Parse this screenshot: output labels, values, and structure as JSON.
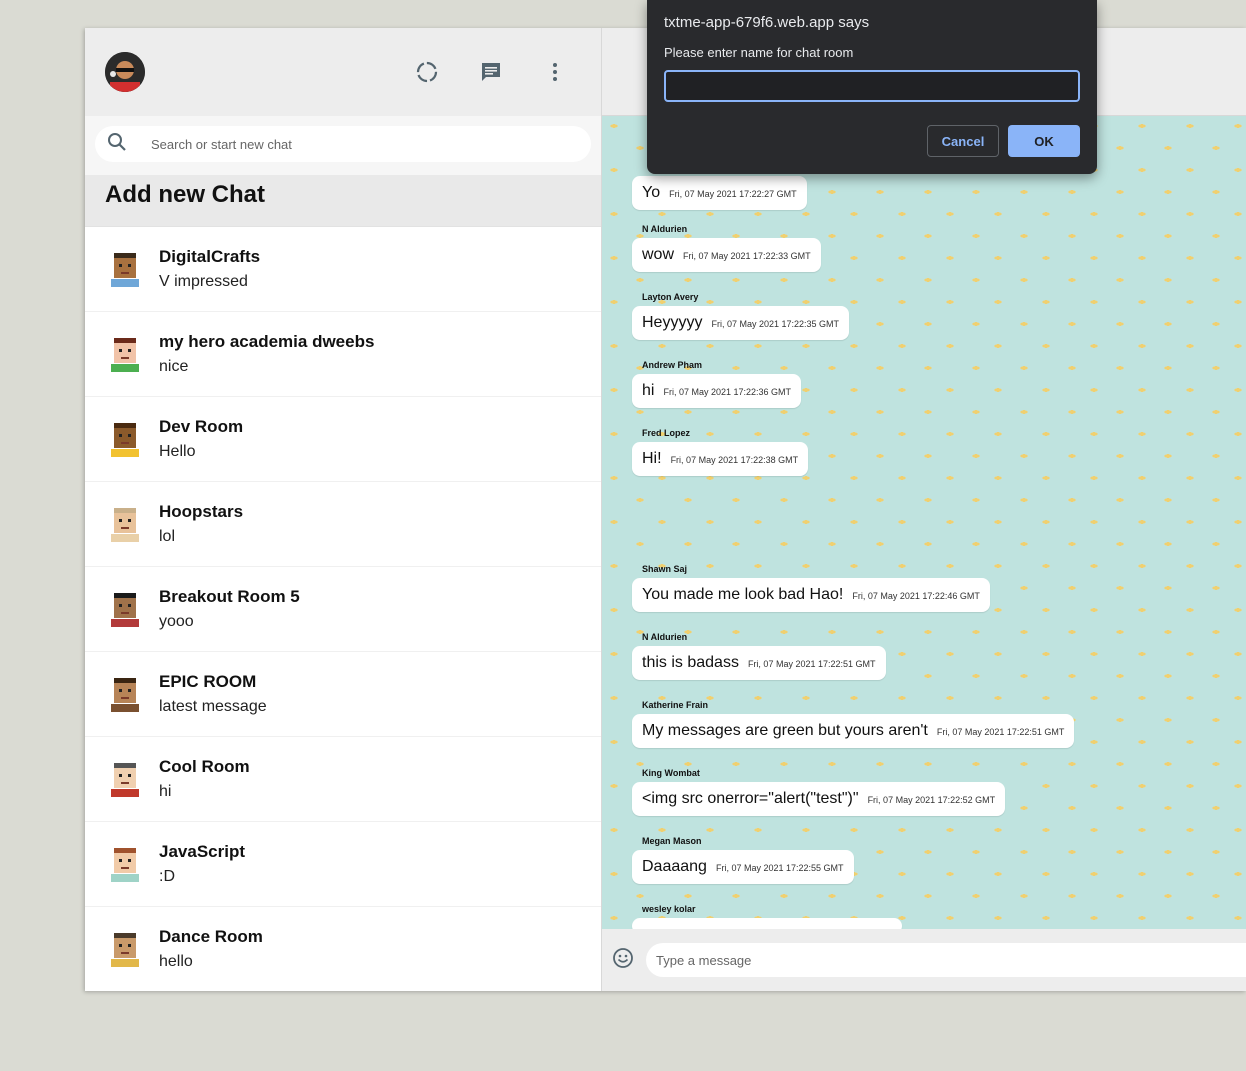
{
  "sidebar": {
    "search_placeholder": "Search or start new chat",
    "add_chat_label": "Add new Chat",
    "chats": [
      {
        "name": "DigitalCrafts",
        "last": "V impressed",
        "skin": "#a8713f",
        "shirt": "#6fa7d8",
        "hair": "#3a2a1a"
      },
      {
        "name": "my hero academia dweebs",
        "last": "nice",
        "skin": "#f1c3a8",
        "shirt": "#4caf50",
        "hair": "#6b2a1a"
      },
      {
        "name": "Dev Room",
        "last": "Hello",
        "skin": "#8b5a2b",
        "shirt": "#f2c230",
        "hair": "#4a2a10"
      },
      {
        "name": "Hoopstars",
        "last": "lol",
        "skin": "#e8c29a",
        "shirt": "#e9d0a8",
        "hair": "#c9b08a"
      },
      {
        "name": "Breakout Room 5",
        "last": "yooo",
        "skin": "#a0724a",
        "shirt": "#b23a3a",
        "hair": "#1a1a1a"
      },
      {
        "name": "EPIC ROOM",
        "last": "latest message",
        "skin": "#b78457",
        "shirt": "#7a5030",
        "hair": "#3a2512"
      },
      {
        "name": "Cool Room",
        "last": "hi",
        "skin": "#f0d0b0",
        "shirt": "#c0392b",
        "hair": "#555555"
      },
      {
        "name": "JavaScript",
        "last": ":D",
        "skin": "#f1cba8",
        "shirt": "#9fd3c7",
        "hair": "#a0522d"
      },
      {
        "name": "Dance Room",
        "last": "hello",
        "skin": "#c99a6a",
        "shirt": "#e2b84a",
        "hair": "#4a3a2a"
      }
    ]
  },
  "messages": [
    {
      "sender": "",
      "text": "Yo",
      "time": "Fri, 07 May 2021 17:22:27 GMT"
    },
    {
      "sender": "N Aldurien",
      "text": "wow",
      "time": "Fri, 07 May 2021 17:22:33 GMT"
    },
    {
      "sender": "Layton Avery",
      "text": "Heyyyyy",
      "time": "Fri, 07 May 2021 17:22:35 GMT"
    },
    {
      "sender": "Andrew Pham",
      "text": "hi",
      "time": "Fri, 07 May 2021 17:22:36 GMT"
    },
    {
      "sender": "Fred Lopez",
      "text": "Hi!",
      "time": "Fri, 07 May 2021 17:22:38 GMT"
    },
    {
      "sender": "Shawn Saj",
      "text": "You made me look bad Hao!",
      "time": "Fri, 07 May 2021 17:22:46 GMT"
    },
    {
      "sender": "N Aldurien",
      "text": "this is badass",
      "time": "Fri, 07 May 2021 17:22:51 GMT"
    },
    {
      "sender": "Katherine Frain",
      "text": "My messages are green but yours aren't",
      "time": "Fri, 07 May 2021 17:22:51 GMT"
    },
    {
      "sender": "King Wombat",
      "text": "<img src onerror=\"alert(\"test\")\"",
      "time": "Fri, 07 May 2021 17:22:52 GMT"
    },
    {
      "sender": "Megan Mason",
      "text": "Daaaang",
      "time": "Fri, 07 May 2021 17:22:55 GMT"
    },
    {
      "sender": "wesley kolar",
      "text": "",
      "time": ""
    }
  ],
  "footer": {
    "input_placeholder": "Type a message"
  },
  "dialog": {
    "title": "txtme-app-679f6.web.app says",
    "message": "Please enter name for chat room",
    "input_value": "",
    "cancel_label": "Cancel",
    "ok_label": "OK"
  },
  "colors": {
    "chat_background": "#bfe3df",
    "dialog_background": "#292a2d",
    "accent": "#8ab4f8"
  },
  "icons": [
    "status-icon",
    "new-chat-icon",
    "menu-dots-icon",
    "search-icon",
    "emoji-icon"
  ]
}
